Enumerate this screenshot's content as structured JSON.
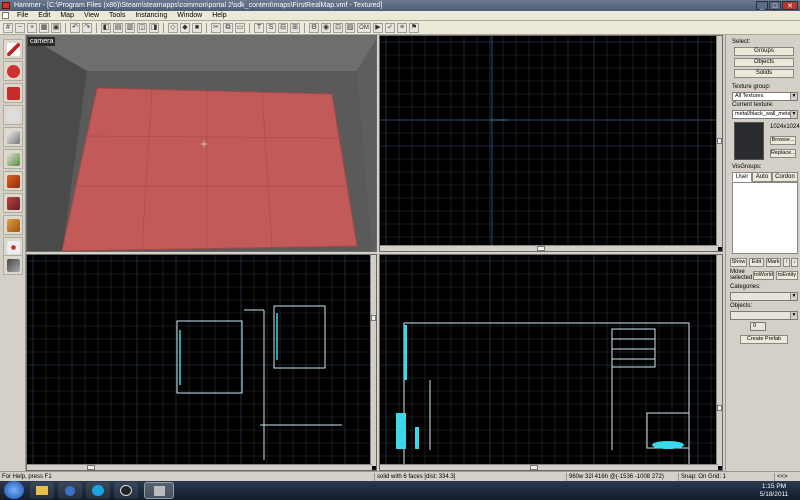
{
  "window": {
    "title": "Hammer - [C:\\Program Files (x86)\\Steam\\steamapps\\common\\portal 2\\sdk_content\\maps\\FirstRealMap.vmf - Textured]",
    "controls": {
      "minimize": "_",
      "maximize": "□",
      "close": "✕"
    }
  },
  "menu": [
    "File",
    "Edit",
    "Map",
    "View",
    "Tools",
    "Instancing",
    "Window",
    "Help"
  ],
  "toolbar": {
    "grid_size_label": "OM"
  },
  "camera_viewport": {
    "label": "camera"
  },
  "right_panel": {
    "select_label": "Select:",
    "select_buttons": [
      "Groups",
      "Objects",
      "Solids"
    ],
    "texture_group_label": "Texture group:",
    "texture_group_value": "All Textures",
    "current_texture_label": "Current texture:",
    "current_texture_value": "metal/black_wall_metal_0",
    "texture_size": "1024x1024",
    "browse_button": "Browse...",
    "replace_button": "Replace...",
    "visgroups_label": "VisGroups:",
    "visgroup_tabs": [
      "User",
      "Auto",
      "Cordon"
    ],
    "visgroup_actions": [
      "Show",
      "Edit",
      "Mark"
    ],
    "visgroup_arrows": [
      "↑",
      "↓"
    ],
    "move_selected_label": "Move selected:",
    "to_world_button": "toWorld",
    "to_entity_button": "toEntity",
    "categories_label": "Categories:",
    "objects_label": "Objects:",
    "prefab_count": "0",
    "create_prefab_button": "Create Prefab"
  },
  "status_bar": {
    "help": "For Help, press F1",
    "selection": "solid with 6 faces   [dist: 334.3]",
    "coords": "960w 32l 416h @(-1536 -1008 272)",
    "snap": "Snap: On Grid: 1",
    "nav": "<<>"
  },
  "taskbar": {
    "time": "1:15 PM",
    "date": "5/18/2011"
  },
  "colors": {
    "camera_floor": "#c25a5a",
    "grid_line": "#2e2e2e",
    "grid_major": "#2f4a70",
    "brush_outline": "#80d0d8",
    "selected_cyan": "#3ad8e8"
  }
}
